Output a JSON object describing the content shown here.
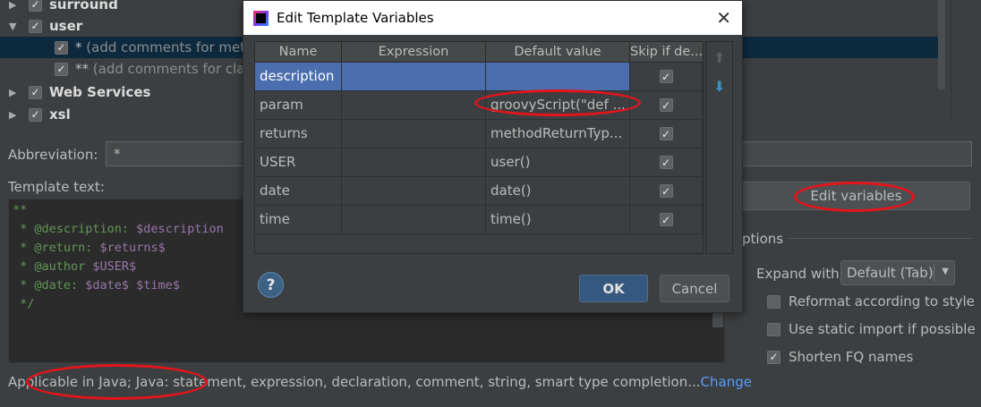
{
  "tree": {
    "groups": [
      {
        "label": "surround",
        "checked": true,
        "expanded": false
      },
      {
        "label": "user",
        "checked": true,
        "expanded": true
      },
      {
        "label": "Web Services",
        "checked": true,
        "expanded": false
      },
      {
        "label": "xsl",
        "checked": true,
        "expanded": false
      }
    ],
    "items": [
      {
        "abbr": "*",
        "desc": "(add comments for meth",
        "checked": true,
        "selected": true
      },
      {
        "abbr": "**",
        "desc": "(add comments for clas",
        "checked": true,
        "selected": false
      }
    ]
  },
  "abbreviation": {
    "label": "Abbreviation:",
    "value": "*"
  },
  "template": {
    "label": "Template text:",
    "lines": [
      [
        "**"
      ],
      [
        " * @description: ",
        "$description"
      ],
      [
        " * @return: ",
        "$returns$"
      ],
      [
        " * @author ",
        "$USER$"
      ],
      [
        " * @date: ",
        "$date$ $time$"
      ],
      [
        " */"
      ]
    ]
  },
  "applicable": {
    "text": "Applicable in Java; Java: statement, expression, declaration, comment, string, smart type completion...",
    "link": "Change"
  },
  "right_panel": {
    "edit_variables": "Edit variables",
    "options_label": "ptions",
    "expand_with_label": "Expand with",
    "expand_with_value": "Default (Tab)",
    "reformat": {
      "label": "Reformat according to style",
      "checked": false
    },
    "static_import": {
      "label": "Use static import if possible",
      "checked": false
    },
    "shorten_fq": {
      "label": "Shorten FQ names",
      "checked": true
    }
  },
  "dialog": {
    "title": "Edit Template Variables",
    "close_icon": "close-icon",
    "columns": [
      "Name",
      "Expression",
      "Default value",
      "Skip if de..."
    ],
    "rows": [
      {
        "name": "description",
        "expression": "",
        "default": "",
        "skip": true
      },
      {
        "name": "param",
        "expression": "",
        "default": "groovyScript(\"def ...",
        "skip": true
      },
      {
        "name": "returns",
        "expression": "",
        "default": "methodReturnTyp...",
        "skip": true
      },
      {
        "name": "USER",
        "expression": "",
        "default": "user()",
        "skip": true
      },
      {
        "name": "date",
        "expression": "",
        "default": "date()",
        "skip": true
      },
      {
        "name": "time",
        "expression": "",
        "default": "time()",
        "skip": true
      }
    ],
    "selected_row": 0,
    "help_label": "?",
    "ok_label": "OK",
    "cancel_label": "Cancel"
  },
  "check_glyph": "✓",
  "colors": {
    "selection": "#4b6eaf",
    "accent_link": "#589df6",
    "annotation": "#e3141a"
  }
}
